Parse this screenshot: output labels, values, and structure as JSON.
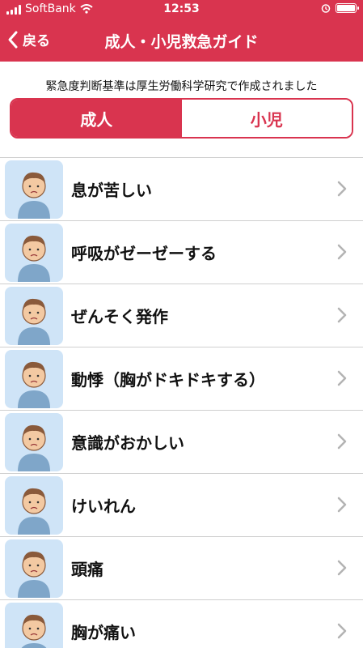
{
  "status": {
    "carrier": "SoftBank",
    "time": "12:53",
    "battery": 0.9
  },
  "nav": {
    "back_label": "戻る",
    "title": "成人・小児救急ガイド"
  },
  "note": "緊急度判断基準は厚生労働科学研究で作成されました",
  "segments": {
    "adult": "成人",
    "child": "小児"
  },
  "items": [
    {
      "label": "息が苦しい",
      "icon": "breathless-person-icon"
    },
    {
      "label": "呼吸がゼーゼーする",
      "icon": "wheezing-person-icon"
    },
    {
      "label": "ぜんそく発作",
      "icon": "inhaler-person-icon"
    },
    {
      "label": "動悸（胸がドキドキする）",
      "icon": "palpitation-person-icon"
    },
    {
      "label": "意識がおかしい",
      "icon": "confused-person-icon"
    },
    {
      "label": "けいれん",
      "icon": "convulsion-person-icon"
    },
    {
      "label": "頭痛",
      "icon": "headache-person-icon"
    },
    {
      "label": "胸が痛い",
      "icon": "chest-pain-person-icon"
    }
  ],
  "colors": {
    "brand": "#d9344f",
    "thumb_bg": "#cfe4f7",
    "chevron": "#b3b3b3"
  }
}
